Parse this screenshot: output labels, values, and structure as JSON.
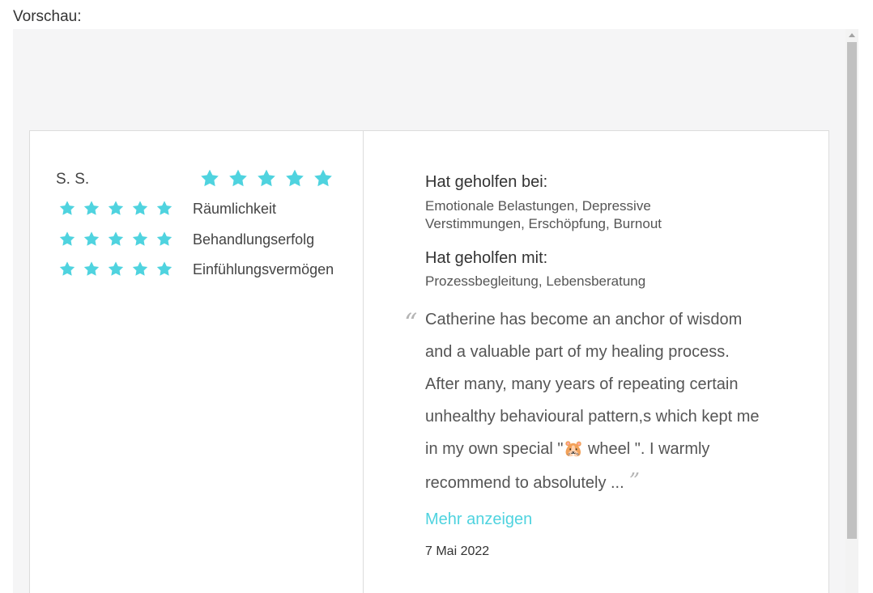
{
  "page": {
    "heading": "Vorschau:"
  },
  "review": {
    "author": "S. S.",
    "overall_stars": 5,
    "ratings": [
      {
        "label": "Räumlichkeit",
        "stars": 5
      },
      {
        "label": "Behandlungserfolg",
        "stars": 5
      },
      {
        "label": "Einfühlungsvermögen",
        "stars": 5
      }
    ],
    "helped_with_title": "Hat geholfen bei:",
    "helped_with_text": "Emotionale Belastungen, Depressive Verstimmungen, Erschöpfung, Burnout",
    "helped_by_title": "Hat geholfen mit:",
    "helped_by_text": "Prozessbegleitung, Lebensberatung",
    "quote_open": "“",
    "quote_text": "Catherine has become an anchor of wisdom and a valuable part of my healing process. After many, many years of repeating certain unhealthy behavioural pattern,s which kept me in my own special \"🐹 wheel \". I warmly recommend to absolutely ...",
    "quote_close": "”",
    "more_label": "Mehr anzeigen",
    "date": "7 Mai 2022"
  },
  "colors": {
    "star": "#4fd3df",
    "link": "#4fd3df",
    "preview_bg": "#f5f5f6"
  }
}
